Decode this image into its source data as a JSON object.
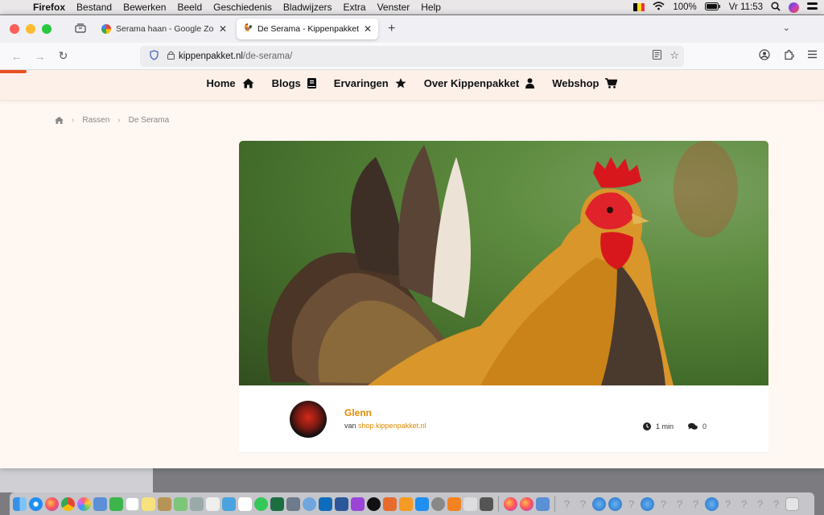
{
  "menubar": {
    "app": "Firefox",
    "items": [
      "Bestand",
      "Bewerken",
      "Beeld",
      "Geschiedenis",
      "Bladwijzers",
      "Extra",
      "Venster",
      "Help"
    ],
    "battery": "100%",
    "clock": "Vr 11:53",
    "flag_colors": [
      "#000000",
      "#fdda24",
      "#ef3340"
    ]
  },
  "browser": {
    "tabs": [
      {
        "title": "Serama haan - Google Zoeken",
        "icon": "google-icon"
      },
      {
        "title": "De Serama - Kippenpakket.nl",
        "icon": "kippenpakket-icon"
      }
    ],
    "url_host": "kippenpakket.nl",
    "url_path": "/de-serama/"
  },
  "site": {
    "nav": [
      {
        "label": "Home",
        "icon": "house-icon"
      },
      {
        "label": "Blogs",
        "icon": "book-icon"
      },
      {
        "label": "Ervaringen",
        "icon": "star-icon"
      },
      {
        "label": "Over Kippenpakket",
        "icon": "user-icon"
      },
      {
        "label": "Webshop",
        "icon": "cart-icon"
      }
    ],
    "breadcrumb": {
      "crumb1": "Rassen",
      "crumb2": "De Serama"
    },
    "author": {
      "name": "Glenn",
      "from_prefix": "van",
      "from_link": "shop.kippenpakket.nl"
    },
    "meta": {
      "read_time": "1 min",
      "comments": "0"
    },
    "colors": {
      "accent": "#e08a00",
      "progress": "#e8501f",
      "background": "#fff7f2"
    }
  }
}
